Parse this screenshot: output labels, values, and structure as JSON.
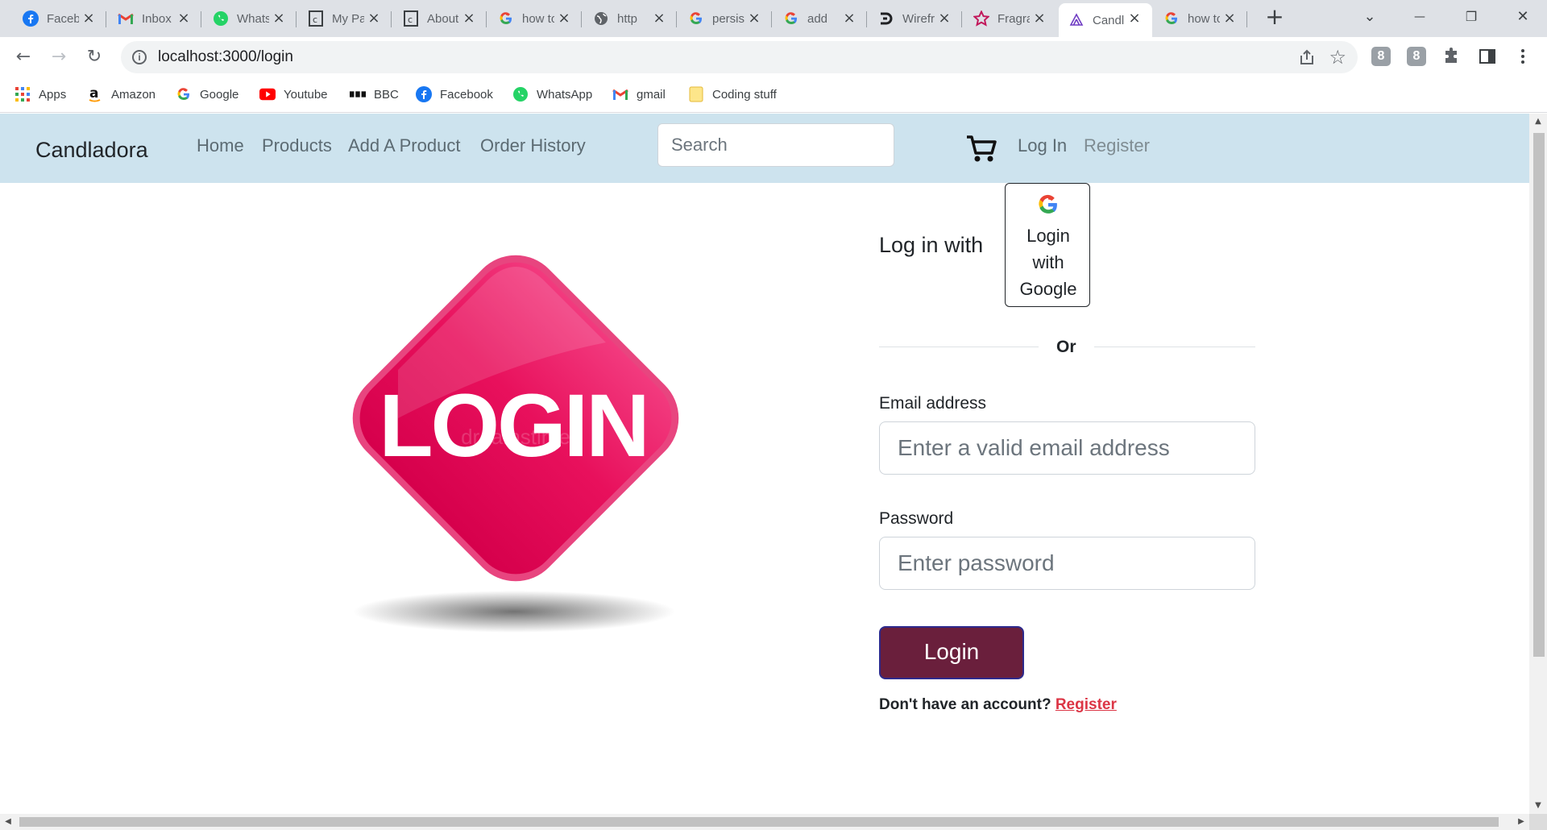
{
  "browser": {
    "tabs": [
      {
        "title": "Facebook",
        "icon": "facebook-icon"
      },
      {
        "title": "Inbox",
        "icon": "gmail-icon"
      },
      {
        "title": "WhatsApp",
        "icon": "whatsapp-icon"
      },
      {
        "title": "My Pages",
        "icon": "document-icon"
      },
      {
        "title": "About",
        "icon": "document-icon"
      },
      {
        "title": "how to",
        "icon": "google-icon"
      },
      {
        "title": "http",
        "icon": "globe-icon"
      },
      {
        "title": "persist",
        "icon": "google-icon"
      },
      {
        "title": "add",
        "icon": "google-icon"
      },
      {
        "title": "Wireframe",
        "icon": "wire-icon"
      },
      {
        "title": "Fragrance",
        "icon": "star-icon"
      },
      {
        "title": "Candladora",
        "icon": "app-icon",
        "active": true
      },
      {
        "title": "how to",
        "icon": "google-icon"
      }
    ],
    "close_glyph": "×",
    "new_tab_glyph": "+",
    "window_controls": {
      "tab_search": "⌄",
      "minimize": "—",
      "restore": "❐",
      "close": "✕"
    },
    "nav": {
      "back": "←",
      "forward": "→",
      "reload": "↻"
    },
    "url": "localhost:3000/login",
    "extension_badges": [
      "8",
      "8"
    ],
    "bookmarks": [
      {
        "label": "Apps",
        "icon": "apps-grid-icon"
      },
      {
        "label": "Amazon",
        "icon": "amazon-icon"
      },
      {
        "label": "Google",
        "icon": "google-icon"
      },
      {
        "label": "Youtube",
        "icon": "youtube-icon"
      },
      {
        "label": "BBC",
        "icon": "bbc-icon"
      },
      {
        "label": "Facebook",
        "icon": "facebook-icon"
      },
      {
        "label": "WhatsApp",
        "icon": "whatsapp-icon"
      },
      {
        "label": "gmail",
        "icon": "gmail-icon"
      },
      {
        "label": "Coding stuff",
        "icon": "folder-icon"
      }
    ]
  },
  "navbar": {
    "brand": "Candladora",
    "links": [
      "Home",
      "Products",
      "Add A Product",
      "Order History"
    ],
    "search_placeholder": "Search",
    "login": "Log In",
    "register": "Register"
  },
  "hero": {
    "text": "LOGIN",
    "watermark": "dreamstime"
  },
  "form": {
    "login_with": "Log in with",
    "google_button": [
      "Login",
      "with",
      "Google"
    ],
    "divider": "Or",
    "email_label": "Email address",
    "email_placeholder": "Enter a valid email address",
    "password_label": "Password",
    "password_placeholder": "Enter password",
    "submit": "Login",
    "no_account": "Don't have an account?",
    "register_link": "Register"
  },
  "colors": {
    "navbar_bg": "#cde3ee",
    "submit_bg": "#6a1f3c",
    "register_link": "#dc3545",
    "hero_pink": "#e8105c"
  }
}
